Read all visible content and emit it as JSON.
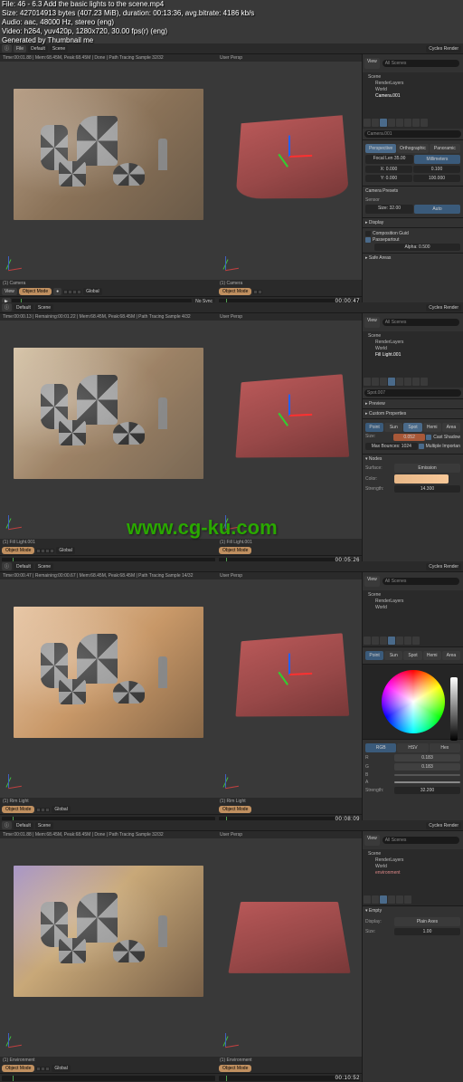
{
  "file_info": {
    "l1": "File: 46 - 6.3 Add the basic lights to the scene.mp4",
    "l2": "Size: 427014913 bytes (407.23 MiB), duration: 00:13:36, avg.bitrate: 4186 kb/s",
    "l3": "Audio: aac, 48000 Hz, stereo (eng)",
    "l4": "Video: h264, yuv420p, 1280x720, 30.00 fps(r) (eng)",
    "l5": "Generated by Thumbnail me"
  },
  "watermark": "www.cg-ku.com",
  "topbar": {
    "file": "File",
    "default": "Default",
    "scene": "Scene",
    "engine": "Cycles Render",
    "blender": "Blender"
  },
  "panels": [
    {
      "header_left": "Time:00:01.88 | Mem:68.45M, Peak:68.45M | Done | Path Tracing Sample 32/32",
      "header_right": "User Persp",
      "footer_left": "(1) Camera",
      "footer_right": "(1) Camera",
      "timestamp": "00:00:47",
      "outliner": {
        "scene": "Scene",
        "item1": "RenderLayers",
        "item2": "World",
        "item3": "Camera.001"
      },
      "props": {
        "search": "Camera.001",
        "tabs": [
          "Perspective",
          "Orthographic",
          "Panoramic"
        ],
        "focal_label": "Focal Len 35.00",
        "units": "Millimeters",
        "shift_x": "X: 0.000",
        "shift_y": "Y: 0.000",
        "clip_start": "0.100",
        "clip_end": "100.000",
        "presets_label": "Camera Presets",
        "sensor_label": "Sensor",
        "size_val": "Size: 32.00",
        "auto": "Auto",
        "display": "▸ Display",
        "comp_guides": "Composition Guid",
        "passepartout": "Passepartout",
        "alpha": "Alpha: 0.500",
        "safe_areas": "▸ Safe Areas"
      }
    },
    {
      "header_left": "Time:00:00.13 | Remaining:00:01.22 | Mem:68.45M, Peak:68.45M | Path Tracing Sample 4/32",
      "header_right": "User Persp",
      "footer_left": "(1) Fill Light.001",
      "footer_right": "(1) Fill Light.001",
      "timestamp": "00:05:26",
      "outliner": {
        "scene": "Scene",
        "item1": "RenderLayers",
        "item2": "World",
        "item3": "Fill Light.001"
      },
      "props": {
        "lamp_name": "Spot.007",
        "preview": "▸ Preview",
        "custom_prop": "▸ Custom Properties",
        "light_types": [
          "Point",
          "Sun",
          "Spot",
          "Hemi",
          "Area"
        ],
        "size_label": "Size:",
        "size_val": "0.052",
        "cast_shadow": "Cast Shadow",
        "max_bounce": "Max Bounces: 1024",
        "mult_imp": "Multiple Importan",
        "nodes": "▾ Nodes",
        "surface_label": "Surface:",
        "emission": "Emission",
        "color_label": "Color:",
        "strength_label": "Strength:",
        "strength_val": "14.300"
      }
    },
    {
      "header_left": "Time:00:00.47 | Remaining:00:00.67 | Mem:68.45M, Peak:68.45M | Path Tracing Sample 14/32",
      "header_right": "User Persp",
      "footer_left": "(1) Rim Light",
      "footer_right": "(1) Rim Light",
      "timestamp": "00:08:09",
      "outliner": {
        "scene": "Scene",
        "item1": "RenderLayers",
        "item2": "World"
      },
      "props": {
        "light_types": [
          "Point",
          "Sun",
          "Spot",
          "Hemi",
          "Area"
        ],
        "color_modes": [
          "RGB",
          "HSV",
          "Hex"
        ],
        "r_label": "R",
        "r_val": "0.183",
        "g_label": "G",
        "g_val": "0.183",
        "b_label": "B",
        "b_val": "",
        "a_label": "A",
        "a_val": "",
        "strength_label": "Strength:",
        "strength_val": "32.200"
      }
    },
    {
      "header_left": "Time:00:01.88 | Mem:68.45M, Peak:68.45M | Done | Path Tracing Sample 32/32",
      "header_right": "User Persp",
      "footer_left": "(1) Environment",
      "footer_right": "(1) Environment",
      "timestamp": "00:10:52",
      "outliner": {
        "scene": "Scene",
        "item1": "RenderLayers",
        "item2": "World",
        "item3": "environment"
      },
      "props": {
        "empty_label": "▾ Empty",
        "display_label": "Display:",
        "plain_axes": "Plain Axes",
        "size_label": "Size:",
        "size_val": "1.00"
      }
    }
  ],
  "toolbar": {
    "view": "View",
    "object_mode": "Object Mode",
    "global": "Global",
    "nosync": "No Sync"
  }
}
